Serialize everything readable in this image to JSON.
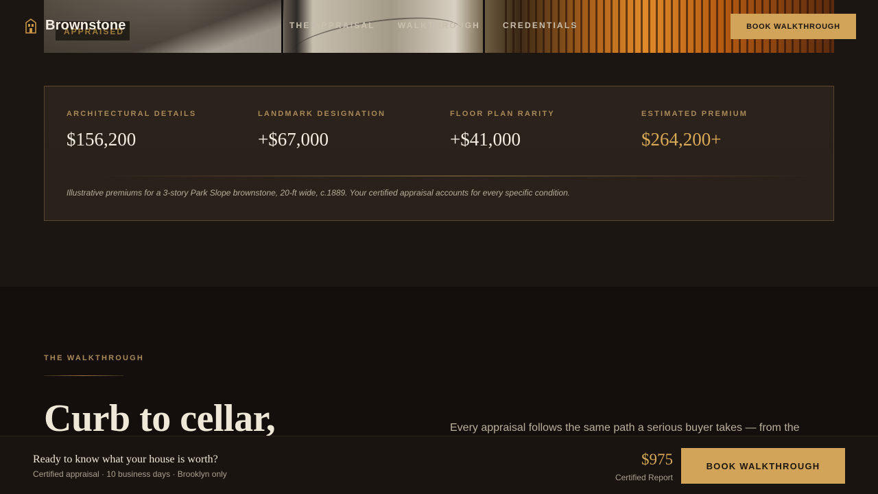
{
  "header": {
    "brand_name": "Brownstone",
    "logo_icon": "brownstone-building-icon",
    "nav": [
      {
        "label": "THE APPRAISAL"
      },
      {
        "label": "WALKTHROUGH"
      },
      {
        "label": "CREDENTIALS"
      }
    ],
    "cta_label": "BOOK WALKTHROUGH"
  },
  "hero": {
    "badge_text": "APPRAISED"
  },
  "premium_card": {
    "stats": [
      {
        "label": "ARCHITECTURAL DETAILS",
        "value": "$156,200"
      },
      {
        "label": "LANDMARK DESIGNATION",
        "value": "+$67,000"
      },
      {
        "label": "FLOOR PLAN RARITY",
        "value": "+$41,000"
      },
      {
        "label": "ESTIMATED PREMIUM",
        "value": "$264,200+"
      }
    ],
    "note": "Illustrative premiums for a 3-story Park Slope brownstone, 20-ft wide, c.1889. Your certified appraisal accounts for every specific condition."
  },
  "walkthrough": {
    "eyebrow": "THE WALKTHROUGH",
    "title": "Curb to cellar,",
    "body": "Every appraisal follows the same path a serious buyer takes — from the"
  },
  "sticky_bar": {
    "headline": "Ready to know what your house is worth?",
    "subline": "Certified appraisal · 10 business days · Brooklyn only",
    "price": "$975",
    "price_caption": "Certified Report",
    "cta_label": "BOOK WALKTHROUGH"
  },
  "colors": {
    "background": "#1b1611",
    "section_dark": "#140f0c",
    "accent_gold": "#d1a45a",
    "label_gold": "#a8895a",
    "text_light": "#efe7d8"
  }
}
